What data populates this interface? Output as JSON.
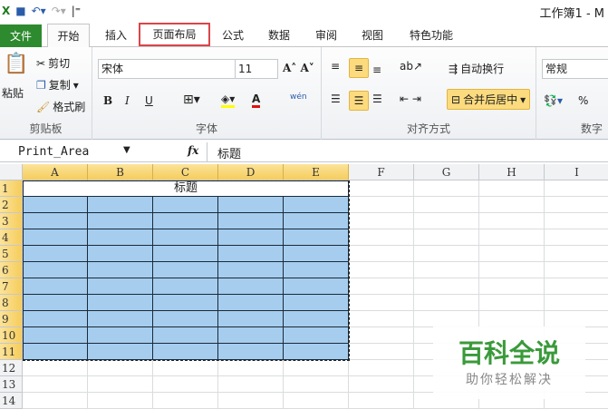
{
  "window": {
    "title": "工作簿1 - M"
  },
  "tabs": [
    "文件",
    "开始",
    "插入",
    "页面布局",
    "公式",
    "数据",
    "审阅",
    "视图",
    "特色功能"
  ],
  "clipboard": {
    "paste": "粘贴",
    "cut": "剪切",
    "copy": "复制",
    "format_painter": "格式刷",
    "label": "剪贴板"
  },
  "font": {
    "name": "宋体",
    "size": "11",
    "bold": "B",
    "italic": "I",
    "underline": "U",
    "font_color": "A",
    "phonetic": "wén",
    "label": "字体"
  },
  "alignment": {
    "wrap": "自动换行",
    "merge": "合并后居中",
    "label": "对齐方式"
  },
  "number": {
    "format": "常规",
    "percent": "%",
    "label": "数字"
  },
  "formula_bar": {
    "name_box": "Print_Area",
    "fx": "fx",
    "value": "标题"
  },
  "columns": [
    "A",
    "B",
    "C",
    "D",
    "E",
    "F",
    "G",
    "H",
    "I"
  ],
  "rows": [
    "1",
    "2",
    "3",
    "4",
    "5",
    "6",
    "7",
    "8",
    "9",
    "10",
    "11",
    "12",
    "13",
    "14"
  ],
  "cells": {
    "A1": "标题"
  },
  "watermark": {
    "title": "百科全说",
    "subtitle": "助你轻松解决"
  }
}
